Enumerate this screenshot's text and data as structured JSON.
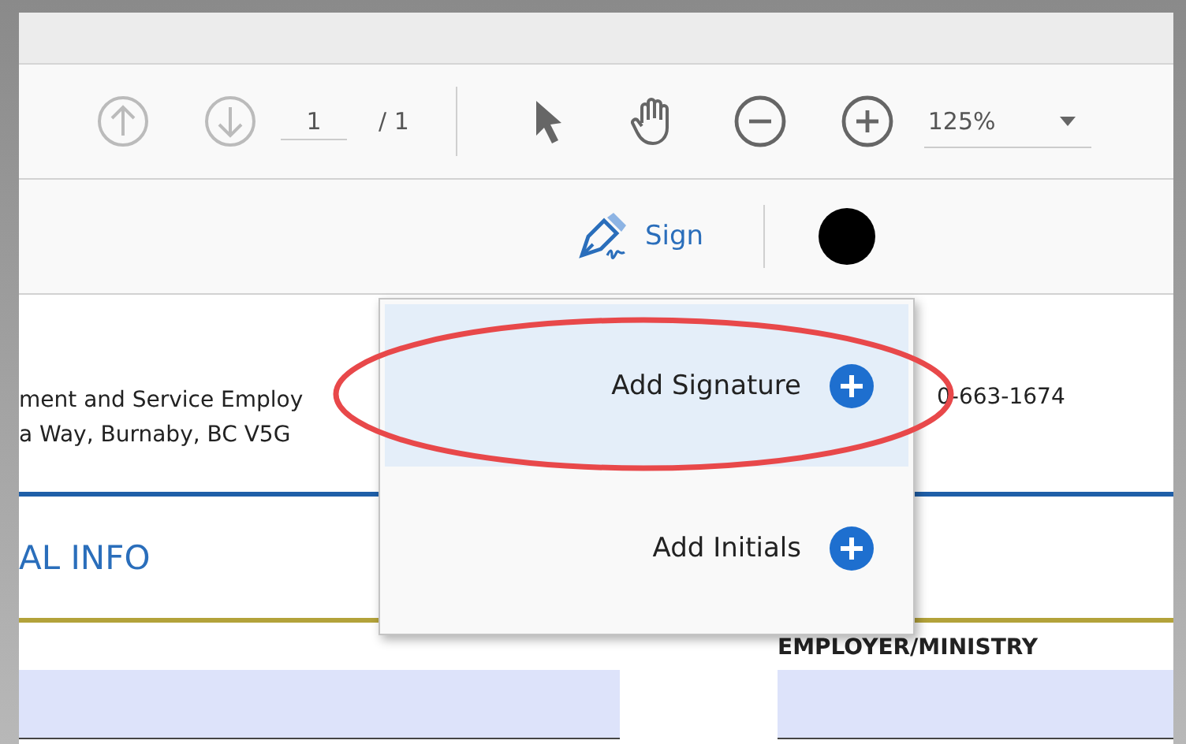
{
  "toolbar": {
    "page_number": "1",
    "page_total": "/ 1",
    "zoom": "125%"
  },
  "sign_bar": {
    "label": "Sign"
  },
  "document": {
    "address_lines": [
      "ment and Service Employ",
      "a Way, Burnaby, BC V5G"
    ],
    "phone": "0-663-1674",
    "section_title": "AL INFO",
    "field_label": "EMPLOYER/MINISTRY"
  },
  "sign_menu": {
    "items": [
      {
        "label": "Add Signature",
        "selected": true
      },
      {
        "label": "Add Initials",
        "selected": false
      }
    ]
  },
  "annotation": {
    "kind": "ellipse"
  }
}
